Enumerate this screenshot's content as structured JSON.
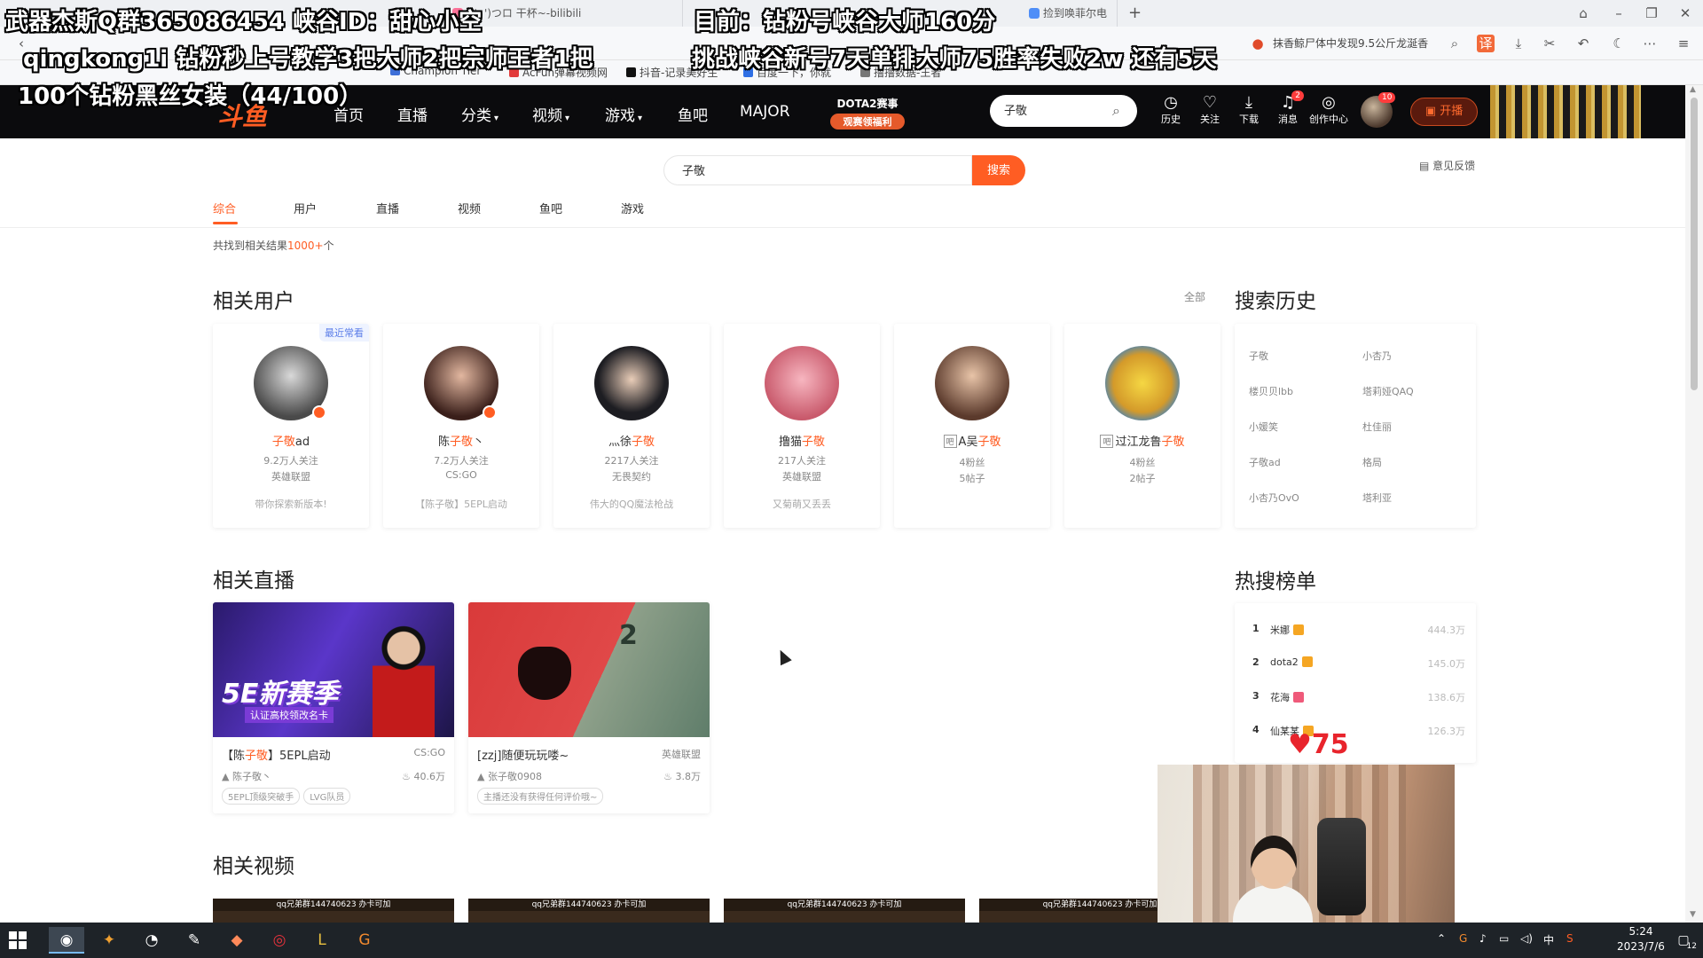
{
  "browser": {
    "tabs": [
      {
        "title": "( '- ')つロ 干杯~-bilibili",
        "icon_color": "#fb7299"
      },
      {
        "title": "捡到唤菲尔电",
        "icon_color": "#4f8ef7"
      }
    ],
    "new_tab": "+",
    "news": "抹香鲸尸体中发现9.5公斤龙涎香",
    "bookmarks": [
      {
        "label": "Champion Tier",
        "color": "#3e6fd8"
      },
      {
        "label": "AcFun弹幕视频网",
        "color": "#e23b3b"
      },
      {
        "label": "抖音-记录美好生",
        "color": "#111111"
      },
      {
        "label": "百度一下，你就",
        "color": "#2f6fe4"
      },
      {
        "label": "撸撸数据-王者",
        "color": "#777777"
      }
    ]
  },
  "overlay": {
    "line1_left": "武器杰斯Q群365086454 峡谷ID：甜心小空",
    "line2_left": "qingkong1i 钻粉秒上号教学3把大师2把宗师王者1把",
    "line3_left": "100个钻粉黑丝女装（44/100）",
    "line1_right": "目前：钻粉号峡谷大师160分",
    "line2_right": "挑战峡谷新号7天单排大师75胜率失败2w 还有5天"
  },
  "header": {
    "logo": "斗鱼",
    "nav": [
      {
        "label": "首页",
        "caret": ""
      },
      {
        "label": "直播",
        "caret": ""
      },
      {
        "label": "分类",
        "caret": "▾"
      },
      {
        "label": "视频",
        "caret": "▾"
      },
      {
        "label": "游戏",
        "caret": "▾"
      },
      {
        "label": "鱼吧",
        "caret": ""
      },
      {
        "label": "MAJOR",
        "caret": ""
      }
    ],
    "dota_title": "DOTA2赛事",
    "dota_sub": "观赛领福利",
    "search_value": "子敬",
    "buttons": [
      {
        "label": "历史",
        "icon": "clock-icon",
        "glyph": "◷",
        "badge": ""
      },
      {
        "label": "关注",
        "icon": "heart-icon",
        "glyph": "♡",
        "badge": ""
      },
      {
        "label": "下载",
        "icon": "download-icon",
        "glyph": "⤓",
        "badge": ""
      },
      {
        "label": "消息",
        "icon": "bell-icon",
        "glyph": "♫",
        "badge": "2"
      },
      {
        "label": "创作中心",
        "icon": "location-icon",
        "glyph": "◎",
        "badge": ""
      }
    ],
    "avatar_badge": "10",
    "live_button": "开播"
  },
  "search": {
    "value": "子敬",
    "button": "搜索",
    "feedback": "意见反馈"
  },
  "tabs": [
    "综合",
    "用户",
    "直播",
    "视频",
    "鱼吧",
    "游戏"
  ],
  "result_count": {
    "prefix": "共找到相关结果",
    "count": "1000+",
    "suffix": "个"
  },
  "users": {
    "title": "相关用户",
    "all": "全部",
    "items": [
      {
        "pre": "",
        "hl": "子敬",
        "post": "ad",
        "anchor": false,
        "line1": "9.2万人关注",
        "line2": "英雄联盟",
        "desc": "带你探索新版本!",
        "recent": "最近常看",
        "avatar": "#5a5a5a"
      },
      {
        "pre": "陈",
        "hl": "子敬",
        "post": "丶",
        "anchor": false,
        "line1": "7.2万人关注",
        "line2": "CS:GO",
        "desc": "【陈子敬】5EPL启动",
        "recent": "",
        "avatar": "#6b3a2e"
      },
      {
        "pre": "灬徐",
        "hl": "子敬",
        "post": "",
        "anchor": false,
        "line1": "2217人关注",
        "line2": "无畏契约",
        "desc": "伟大的QQ魔法枪战",
        "recent": "",
        "avatar": "#2a2a30"
      },
      {
        "pre": "撸猫",
        "hl": "子敬",
        "post": "",
        "anchor": false,
        "line1": "217人关注",
        "line2": "英雄联盟",
        "desc": "又菊萌又丢丢",
        "recent": "",
        "avatar": "#e88f9a"
      },
      {
        "pre": "A吴",
        "hl": "子敬",
        "post": "",
        "anchor": true,
        "line1": "4粉丝",
        "line2": "5帖子",
        "desc": "",
        "recent": "",
        "avatar": "#7a5040"
      },
      {
        "pre": "过江龙鲁",
        "hl": "子敬",
        "post": "",
        "anchor": true,
        "line1": "4粉丝",
        "line2": "2帖子",
        "desc": "",
        "recent": "",
        "avatar": "#e6c34a"
      }
    ],
    "anchor_tag": "吧"
  },
  "history": {
    "title": "搜索历史",
    "items": [
      "子敬",
      "小杏乃",
      "楼贝贝lbb",
      "塔莉娅QAQ",
      "小媛笑",
      "杜佳丽",
      "子敬ad",
      "格局",
      "小杏乃OvO",
      "塔利亚"
    ]
  },
  "live": {
    "title": "相关直播",
    "items": [
      {
        "pre": "【陈",
        "hl": "子敬",
        "post": "】5EPL启动",
        "category": "CS:GO",
        "streamer": "陈子敬丶",
        "heat": "40.6万",
        "tags": [
          "5EPL顶级突破手",
          "LVG队员"
        ],
        "thumb_text": "5E新赛季",
        "thumb_sub": "认证高校领改名卡"
      },
      {
        "pre": "[zzj]随便玩玩喽~",
        "hl": "",
        "post": "",
        "category": "英雄联盟",
        "streamer": "张子敬0908",
        "heat": "3.8万",
        "tags": [
          "主播还没有获得任何评价哦~"
        ],
        "thumb_text": "",
        "thumb_sub": ""
      }
    ]
  },
  "hot": {
    "title": "热搜榜单",
    "items": [
      {
        "rank": "1",
        "name": "米娜",
        "value": "444.3万",
        "badge": "#f5a623"
      },
      {
        "rank": "2",
        "name": "dota2",
        "value": "145.0万",
        "badge": "#f5a623"
      },
      {
        "rank": "3",
        "name": "花海",
        "value": "138.6万",
        "badge": "#ef5a7a"
      },
      {
        "rank": "4",
        "name": "仙某某",
        "value": "126.3万",
        "badge": "#f5a623"
      }
    ]
  },
  "videos": {
    "title": "相关视频",
    "caption": "qq兄弟群144740623 办卡可加"
  },
  "stream": {
    "heart_count": "75"
  },
  "taskbar": {
    "time": "5:24",
    "date": "2023/7/6",
    "ime": "中",
    "notifications": "12"
  }
}
